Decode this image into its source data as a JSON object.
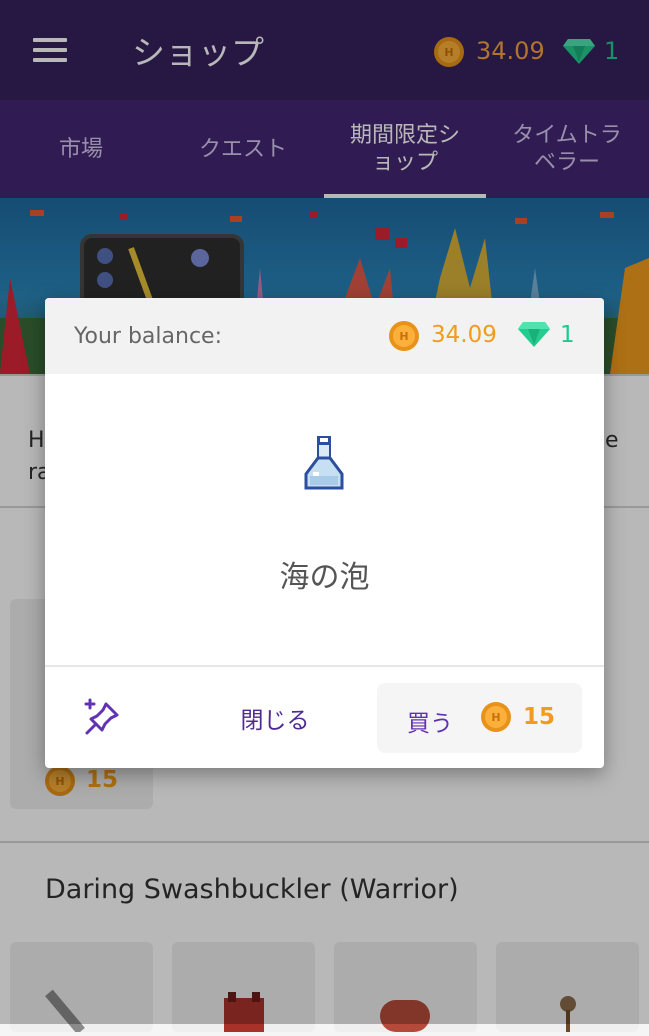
{
  "appbar": {
    "title": "ショップ",
    "gold": "34.09",
    "gems": "1"
  },
  "tabs": [
    {
      "label": "市場",
      "active": false
    },
    {
      "label": "クエスト",
      "active": false
    },
    {
      "label": "期間限定シ\nョップ",
      "active": true
    },
    {
      "label": "タイムトラ\nベラー",
      "active": false
    }
  ],
  "background": {
    "desc_start": "H",
    "desc_start2": "ra",
    "desc_end": "e",
    "card_price": "15",
    "section_title": "Daring Swashbuckler (Warrior)"
  },
  "modal": {
    "balance_label": "Your balance:",
    "gold": "34.09",
    "gems": "1",
    "item_name": "海の泡",
    "close_label": "閉じる",
    "buy_label": "買う",
    "price": "15"
  },
  "colors": {
    "appbar": "#36205d",
    "tabs": "#432874",
    "gold": "#f29b1c",
    "gem": "#1fc98d",
    "accent": "#6133b4"
  }
}
